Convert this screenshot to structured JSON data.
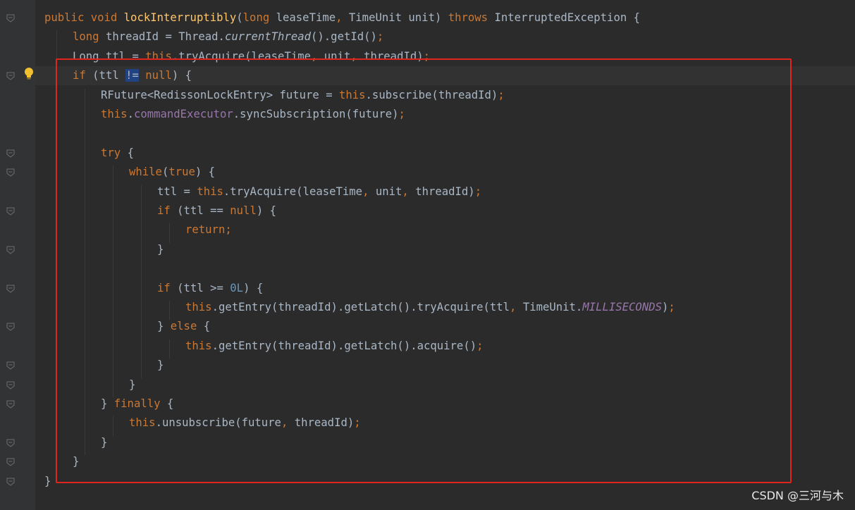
{
  "code_lines": [
    {
      "indent": 0,
      "tokens": [
        [
          "kw",
          "public void "
        ],
        [
          "fn",
          "lockInterruptibly"
        ],
        [
          "",
          "("
        ],
        [
          "kw",
          "long "
        ],
        [
          "",
          "leaseTime"
        ],
        [
          "kw",
          ", "
        ],
        [
          "",
          "TimeUnit unit) "
        ],
        [
          "kw",
          "throws "
        ],
        [
          "",
          "InterruptedException {"
        ]
      ]
    },
    {
      "indent": 1,
      "tokens": [
        [
          "kw",
          "long "
        ],
        [
          "",
          "threadId = Thread."
        ],
        [
          "ital",
          "currentThread"
        ],
        [
          "",
          "().getId()"
        ],
        [
          "kw",
          ";"
        ]
      ]
    },
    {
      "indent": 1,
      "tokens": [
        [
          "",
          "Long ttl = "
        ],
        [
          "kw",
          "this"
        ],
        [
          "",
          ".tryAcquire(leaseTime"
        ],
        [
          "kw",
          ", "
        ],
        [
          "",
          "unit"
        ],
        [
          "kw",
          ", "
        ],
        [
          "",
          "threadId)"
        ],
        [
          "kw",
          ";"
        ]
      ]
    },
    {
      "indent": 1,
      "tokens": [
        [
          "kw",
          "if "
        ],
        [
          "",
          "(ttl "
        ],
        [
          "sel",
          "!="
        ],
        [
          "kw",
          " null"
        ],
        [
          "",
          ") {"
        ]
      ]
    },
    {
      "indent": 2,
      "tokens": [
        [
          "",
          "RFuture<RedissonLockEntry> future = "
        ],
        [
          "kw",
          "this"
        ],
        [
          "",
          ".subscribe(threadId)"
        ],
        [
          "kw",
          ";"
        ]
      ]
    },
    {
      "indent": 2,
      "tokens": [
        [
          "kw",
          "this"
        ],
        [
          "",
          "."
        ],
        [
          "fld",
          "commandExecutor"
        ],
        [
          "",
          ".syncSubscription(future)"
        ],
        [
          "kw",
          ";"
        ]
      ]
    },
    {
      "indent": 0,
      "tokens": []
    },
    {
      "indent": 2,
      "tokens": [
        [
          "kw",
          "try "
        ],
        [
          "",
          "{"
        ]
      ]
    },
    {
      "indent": 3,
      "tokens": [
        [
          "kw",
          "while"
        ],
        [
          "",
          "("
        ],
        [
          "kw",
          "true"
        ],
        [
          "",
          ") {"
        ]
      ]
    },
    {
      "indent": 4,
      "tokens": [
        [
          "",
          "ttl = "
        ],
        [
          "kw",
          "this"
        ],
        [
          "",
          ".tryAcquire(leaseTime"
        ],
        [
          "kw",
          ", "
        ],
        [
          "",
          "unit"
        ],
        [
          "kw",
          ", "
        ],
        [
          "",
          "threadId)"
        ],
        [
          "kw",
          ";"
        ]
      ]
    },
    {
      "indent": 4,
      "tokens": [
        [
          "kw",
          "if "
        ],
        [
          "",
          "(ttl == "
        ],
        [
          "kw",
          "null"
        ],
        [
          "",
          ") {"
        ]
      ]
    },
    {
      "indent": 5,
      "tokens": [
        [
          "kw",
          "return;"
        ]
      ]
    },
    {
      "indent": 4,
      "tokens": [
        [
          "",
          "}"
        ]
      ]
    },
    {
      "indent": 0,
      "tokens": []
    },
    {
      "indent": 4,
      "tokens": [
        [
          "kw",
          "if "
        ],
        [
          "",
          "(ttl >= "
        ],
        [
          "num",
          "0L"
        ],
        [
          "",
          ") {"
        ]
      ]
    },
    {
      "indent": 5,
      "tokens": [
        [
          "kw",
          "this"
        ],
        [
          "",
          ".getEntry(threadId).getLatch().tryAcquire(ttl"
        ],
        [
          "kw",
          ", "
        ],
        [
          "",
          "TimeUnit."
        ],
        [
          "const",
          "MILLISECONDS"
        ],
        [
          "",
          ")"
        ],
        [
          "kw",
          ";"
        ]
      ]
    },
    {
      "indent": 4,
      "tokens": [
        [
          "",
          "} "
        ],
        [
          "kw",
          "else "
        ],
        [
          "",
          "{"
        ]
      ]
    },
    {
      "indent": 5,
      "tokens": [
        [
          "kw",
          "this"
        ],
        [
          "",
          ".getEntry(threadId).getLatch().acquire()"
        ],
        [
          "kw",
          ";"
        ]
      ]
    },
    {
      "indent": 4,
      "tokens": [
        [
          "",
          "}"
        ]
      ]
    },
    {
      "indent": 3,
      "tokens": [
        [
          "",
          "}"
        ]
      ]
    },
    {
      "indent": 2,
      "tokens": [
        [
          "",
          "} "
        ],
        [
          "kw",
          "finally "
        ],
        [
          "",
          "{"
        ]
      ]
    },
    {
      "indent": 3,
      "tokens": [
        [
          "kw",
          "this"
        ],
        [
          "",
          ".unsubscribe(future"
        ],
        [
          "kw",
          ", "
        ],
        [
          "",
          "threadId)"
        ],
        [
          "kw",
          ";"
        ]
      ]
    },
    {
      "indent": 2,
      "tokens": [
        [
          "",
          "}"
        ]
      ]
    },
    {
      "indent": 1,
      "tokens": [
        [
          "",
          "}"
        ]
      ]
    },
    {
      "indent": 0,
      "tokens": [
        [
          "",
          "}"
        ]
      ]
    }
  ],
  "colors": {
    "background": "#2b2b2b",
    "gutter": "#313335",
    "keyword": "#cc7832",
    "method": "#ffc66d",
    "number": "#6897bb",
    "field": "#9876aa",
    "text": "#a9b7c6",
    "highlight_box": "#e0251f"
  },
  "icons": {
    "gutter_bulb": "lightbulb-icon",
    "fold_markers": "fold-marker-icon"
  },
  "watermark": "CSDN @三河与木"
}
